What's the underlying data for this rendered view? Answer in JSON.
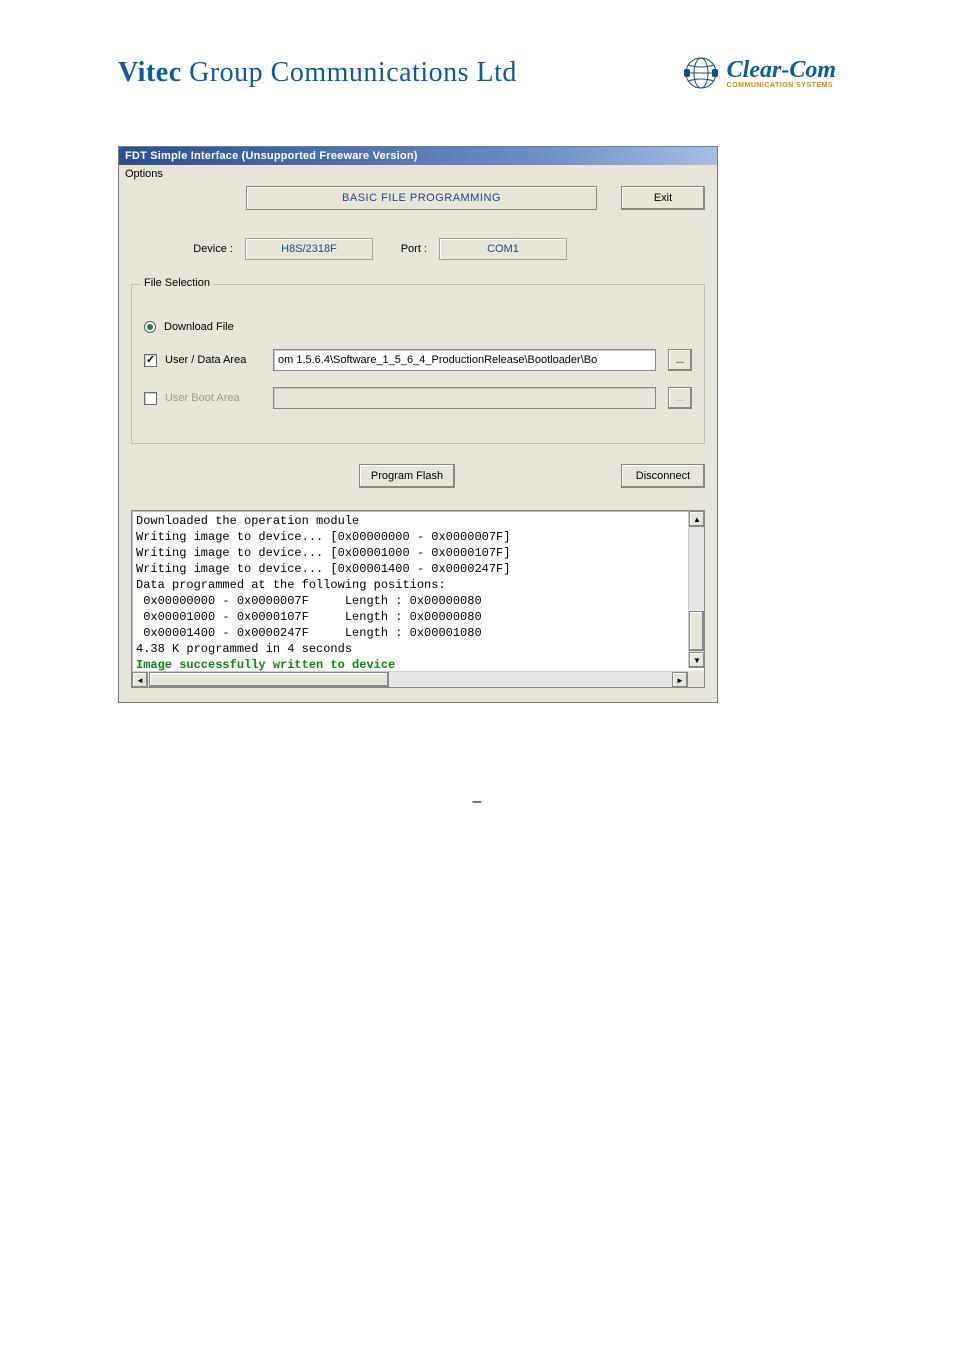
{
  "header": {
    "company_bold": "Vitec",
    "company_light": " Group Communications Ltd",
    "logo_brand": "Clear-Com",
    "logo_sub": "COMMUNICATION SYSTEMS"
  },
  "window": {
    "title": "FDT Simple Interface   (Unsupported Freeware Version)",
    "menu_options": "Options",
    "panel_title": "BASIC FILE PROGRAMMING",
    "exit": "Exit",
    "device_label": "Device :",
    "device_value": "H8S/2318F",
    "port_label": "Port :",
    "port_value": "COM1",
    "fieldset_legend": "File Selection",
    "radio_download": "Download File",
    "chk_user_data": "User / Data Area",
    "user_data_path": "om 1.5.6.4\\Software_1_5_6_4_ProductionRelease\\Bootloader\\Bo",
    "chk_user_boot": "User Boot Area",
    "browse_ellipsis": "...",
    "program_flash": "Program Flash",
    "disconnect": "Disconnect",
    "log_lines": [
      "Downloaded the operation module",
      "Writing image to device... [0x00000000 - 0x0000007F]",
      "Writing image to device... [0x00001000 - 0x0000107F]",
      "Writing image to device... [0x00001400 - 0x0000247F]",
      "Data programmed at the following positions:",
      " 0x00000000 - 0x0000007F     Length : 0x00000080",
      " 0x00001000 - 0x0000107F     Length : 0x00000080",
      " 0x00001400 - 0x0000247F     Length : 0x00001080",
      "4.38 K programmed in 4 seconds"
    ],
    "log_success": "Image successfully written to device"
  },
  "footer_dash": "–"
}
